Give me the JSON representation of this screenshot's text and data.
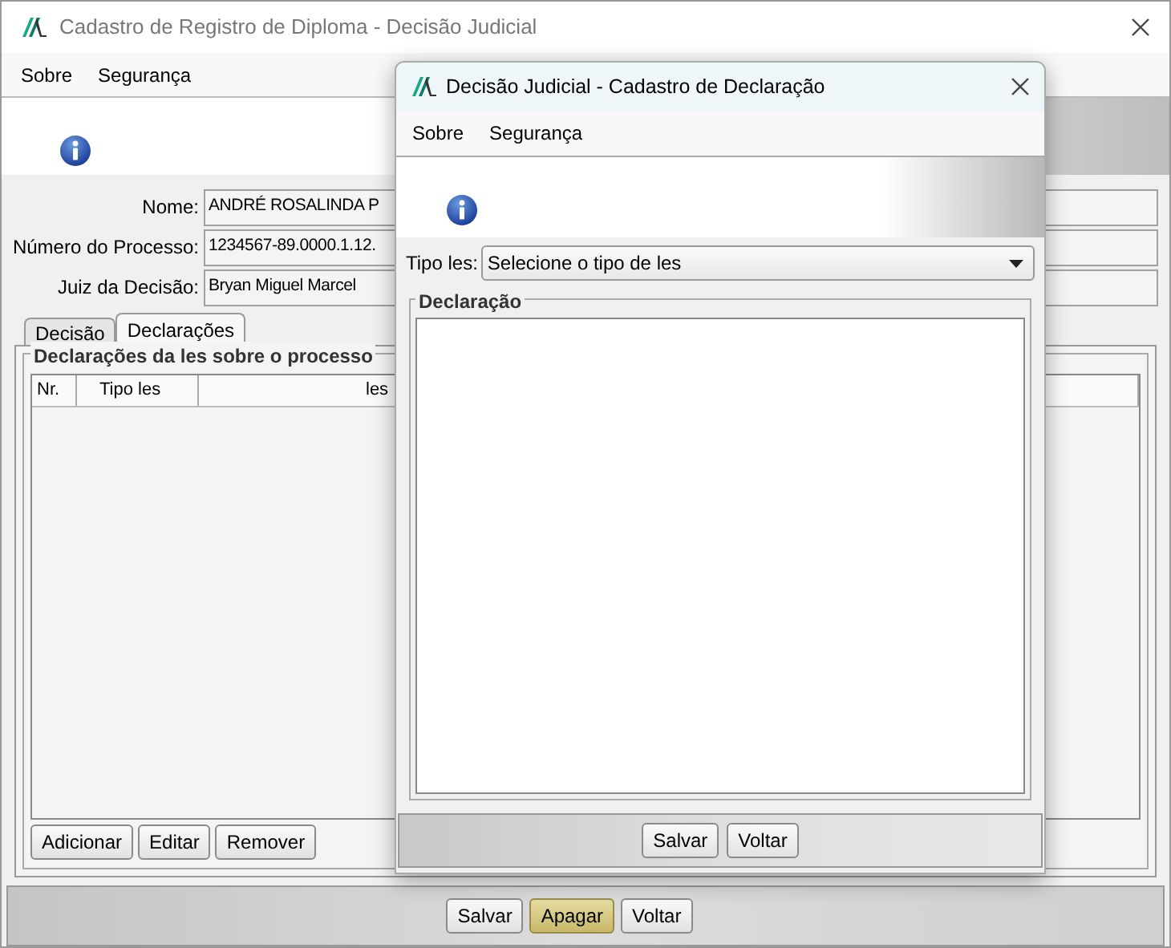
{
  "main_window": {
    "title": "Cadastro de Registro de Diploma - Decisão Judicial",
    "menu": [
      "Sobre",
      "Segurança"
    ],
    "fields": [
      {
        "label": "Nome:",
        "value": "ANDRÉ ROSALINDA P"
      },
      {
        "label": "Número do Processo:",
        "value": "1234567-89.0000.1.12."
      },
      {
        "label": "Juiz da Decisão:",
        "value": "Bryan Miguel Marcel"
      }
    ],
    "tabs": [
      {
        "label": "Decisão",
        "selected": false
      },
      {
        "label": "Declarações",
        "selected": true
      }
    ],
    "group_title": "Declarações da les sobre o processo",
    "table": {
      "columns": [
        "Nr.",
        "Tipo les",
        "les"
      ]
    },
    "table_buttons": [
      "Adicionar",
      "Editar",
      "Remover"
    ],
    "buttons": [
      {
        "label": "Salvar",
        "focused": false
      },
      {
        "label": "Apagar",
        "focused": true
      },
      {
        "label": "Voltar",
        "focused": false
      }
    ]
  },
  "dialog": {
    "title": "Decisão Judicial - Cadastro de Declaração",
    "menu": [
      "Sobre",
      "Segurança"
    ],
    "select": {
      "label": "Tipo les:",
      "value": "Selecione o tipo de les"
    },
    "group_title": "Declaração",
    "buttons": [
      "Salvar",
      "Voltar"
    ]
  }
}
